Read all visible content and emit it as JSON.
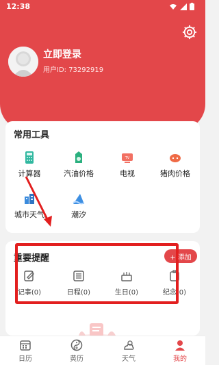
{
  "status": {
    "time": "12:38"
  },
  "profile": {
    "login_label": "立即登录",
    "user_id": "用户ID: 73292919"
  },
  "tools": {
    "title": "常用工具",
    "items": [
      {
        "label": "计算器",
        "icon": "calculator-icon"
      },
      {
        "label": "汽油价格",
        "icon": "fuel-icon"
      },
      {
        "label": "电视",
        "icon": "tv-icon"
      },
      {
        "label": "猪肉价格",
        "icon": "pork-icon"
      },
      {
        "label": "城市天气",
        "icon": "city-weather-icon"
      },
      {
        "label": "潮汐",
        "icon": "tide-icon"
      }
    ]
  },
  "reminders": {
    "title": "重要提醒",
    "add_label": "+ 添加",
    "items": [
      {
        "label": "记事(0)",
        "icon": "note-icon"
      },
      {
        "label": "日程(0)",
        "icon": "schedule-icon"
      },
      {
        "label": "生日(0)",
        "icon": "birthday-icon"
      },
      {
        "label": "纪念(0)",
        "icon": "anniversary-icon"
      }
    ]
  },
  "nav": {
    "items": [
      {
        "label": "日历",
        "icon": "calendar-icon"
      },
      {
        "label": "黄历",
        "icon": "almanac-icon"
      },
      {
        "label": "天气",
        "icon": "weather-icon"
      },
      {
        "label": "我的",
        "icon": "profile-icon"
      }
    ],
    "active": "我的"
  },
  "colors": {
    "accent": "#e3474a",
    "annotation_red": "#e21f1f",
    "background": "#f2f2f2"
  }
}
